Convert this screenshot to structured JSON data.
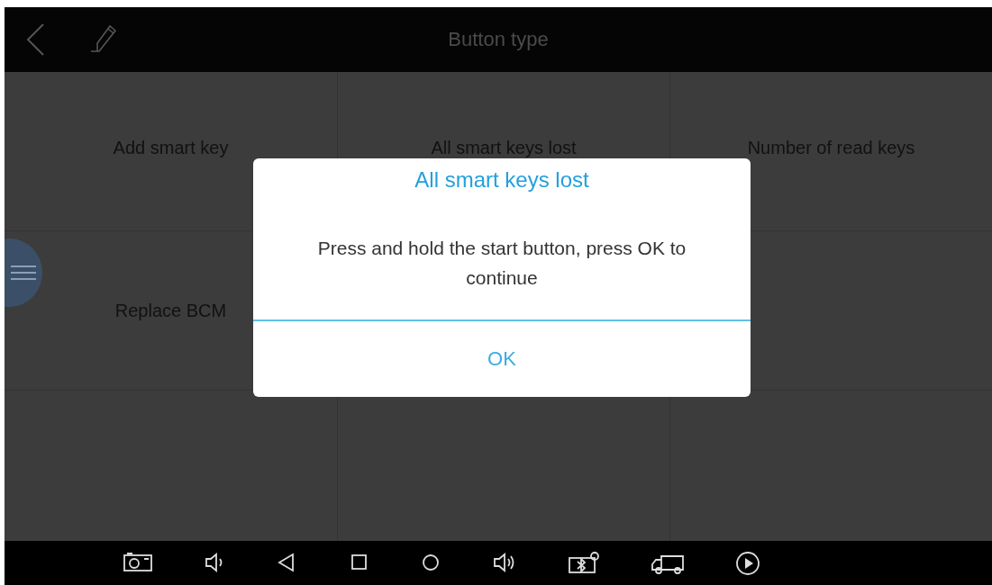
{
  "header": {
    "title": "Button type"
  },
  "functions": [
    {
      "label": "Add smart key"
    },
    {
      "label": "All smart keys lost"
    },
    {
      "label": "Number of read keys"
    },
    {
      "label": "Replace BCM"
    }
  ],
  "dialog": {
    "title": "All smart keys lost",
    "message": "Press and hold the start button, press OK to continue",
    "button": "OK"
  }
}
